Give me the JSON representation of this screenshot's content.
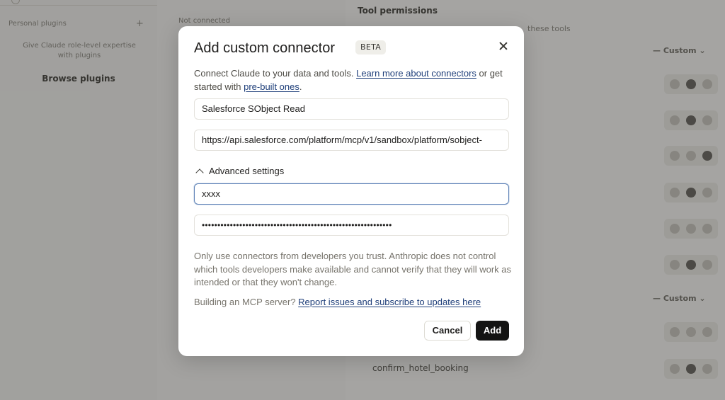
{
  "background": {
    "sidebar": {
      "section_title": "Personal plugins",
      "add_symbol": "+",
      "description": "Give Claude role-level expertise with plugins",
      "browse_label": "Browse plugins"
    },
    "mid_label": "Not connected",
    "main": {
      "tool_permissions_title": "Tool permissions",
      "tool_permissions_sub": "these tools",
      "custom_label": "— Custom ⌄",
      "row_label": "confirm_hotel_booking"
    }
  },
  "modal": {
    "title": "Add custom connector",
    "badge": "BETA",
    "intro_prefix": "Connect Claude to your data and tools. ",
    "intro_link1": "Learn more about connectors",
    "intro_middle": " or get started with ",
    "intro_link2": "pre-built ones",
    "intro_suffix": ".",
    "name_value": "Salesforce SObject Read",
    "url_value": "https://api.salesforce.com/platform/mcp/v1/sandbox/platform/sobject-",
    "advanced_label": "Advanced settings",
    "client_id_value": "xxxx",
    "client_secret_value": "•••••••••••••••••••••••••••••••••••••••••••••••••••••••••••••",
    "disclaimer": "Only use connectors from developers you trust. Anthropic does not control which tools developers make available and cannot verify that they will work as intended or that they won't change.",
    "building_prefix": "Building an MCP server? ",
    "building_link": "Report issues and subscribe to updates here",
    "cancel_label": "Cancel",
    "add_label": "Add"
  },
  "colors": {
    "accent_link": "#1f3f7a",
    "primary_button": "#141413",
    "focus_border": "#5c80b6"
  },
  "icons": [
    "close-icon",
    "chevron-up-icon"
  ]
}
